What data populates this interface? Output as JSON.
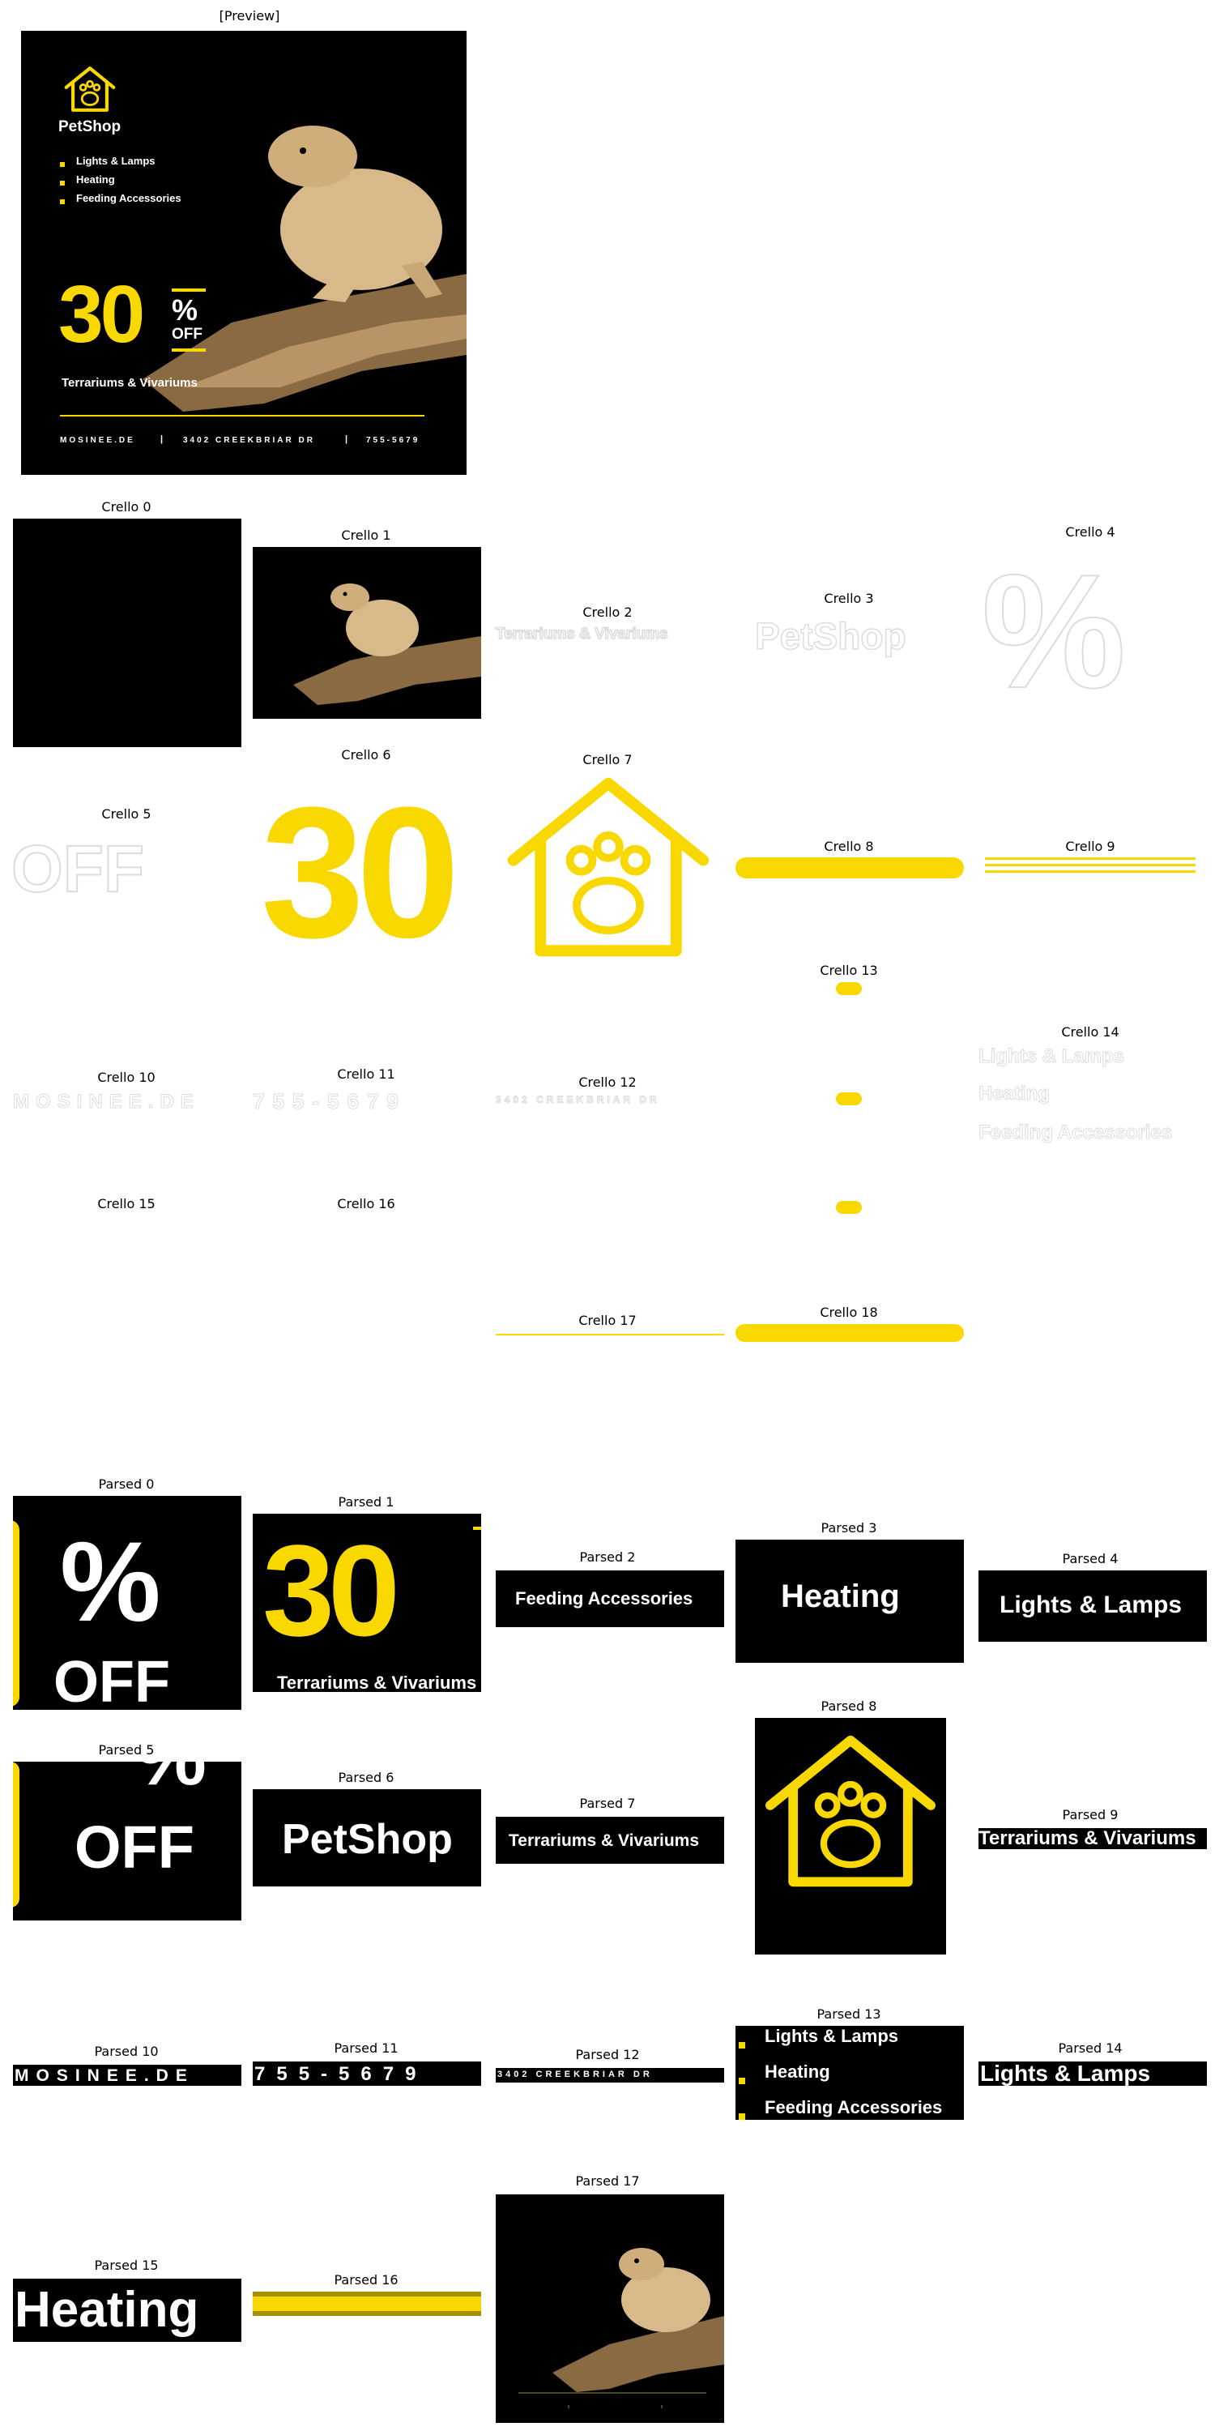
{
  "preview_caption": "[Preview]",
  "brand": "PetShop",
  "features": [
    "Lights & Lamps",
    "Heating",
    "Feeding Accessories"
  ],
  "discount_number": "30",
  "discount_percent": "%",
  "discount_off": "OFF",
  "subtitle": "Terrariums & Vivariums",
  "footer": {
    "site": "MOSINEE.DE",
    "address": "3402 CREEKBRIAR DR",
    "phone": "755-5679",
    "sep": "|"
  },
  "crello": [
    "Crello 0",
    "Crello 1",
    "Crello 2",
    "Crello 3",
    "Crello 4",
    "Crello 5",
    "Crello 6",
    "Crello 7",
    "Crello 8",
    "Crello 9",
    "Crello 10",
    "Crello 11",
    "Crello 12",
    "Crello 13",
    "Crello 14",
    "Crello 15",
    "Crello 16",
    "Crello 17",
    "Crello 18"
  ],
  "parsed": [
    "Parsed 0",
    "Parsed 1",
    "Parsed 2",
    "Parsed 3",
    "Parsed 4",
    "Parsed 5",
    "Parsed 6",
    "Parsed 7",
    "Parsed 8",
    "Parsed 9",
    "Parsed 10",
    "Parsed 11",
    "Parsed 12",
    "Parsed 13",
    "Parsed 14",
    "Parsed 15",
    "Parsed 16",
    "Parsed 17"
  ],
  "colors": {
    "accent": "#f9d800",
    "background": "#000000",
    "lizard": "#d8b98a",
    "wood": "#8a6a42"
  },
  "icons": [
    "paw-house-icon",
    "lizard-photo"
  ]
}
